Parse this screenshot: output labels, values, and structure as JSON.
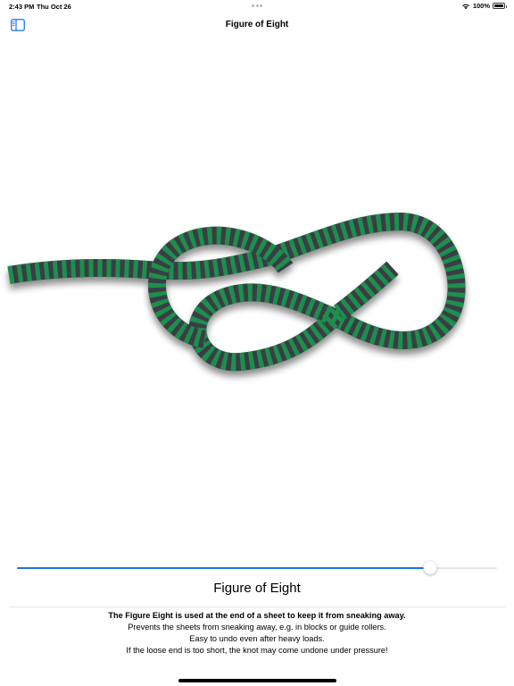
{
  "status_bar": {
    "time": "2:43 PM",
    "date": "Thu Oct 26",
    "battery": "100%",
    "battery_level": 1.0
  },
  "nav": {
    "title": "Figure of Eight",
    "sidebar_icon": "sidebar-toggle-icon"
  },
  "knot": {
    "image_label": "figure-of-eight-knot-rope",
    "rope_colors": [
      "#1f8f4e",
      "#3a3e45"
    ],
    "title": "Figure of Eight",
    "progress": 0.86
  },
  "description": {
    "lead": "The Figure Eight is used at the end of a sheet to keep it from sneaking away.",
    "lines": [
      "Prevents the sheets from sneaking away, e.g. in blocks or guide rollers.",
      "Easy to undo even after heavy loads.",
      "If the loose end is too short, the knot may come undone under pressure!"
    ]
  },
  "colors": {
    "accent": "#1a73e8"
  }
}
